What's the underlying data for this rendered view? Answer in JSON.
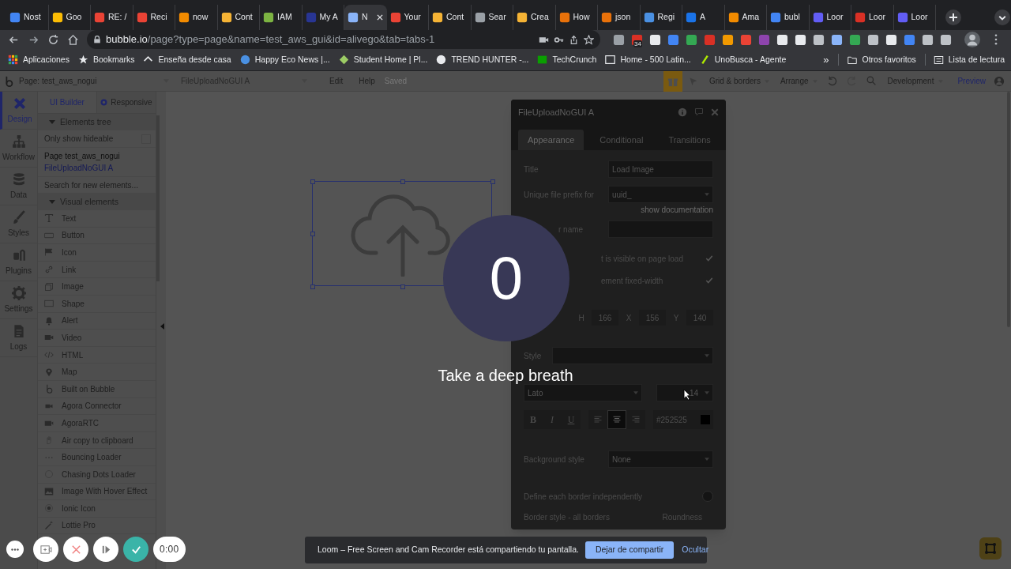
{
  "browser": {
    "tabs": [
      {
        "title": "Nost",
        "selected": false
      },
      {
        "title": "Goo",
        "selected": false
      },
      {
        "title": "RE: /",
        "selected": false
      },
      {
        "title": "Reci",
        "selected": false
      },
      {
        "title": "now",
        "selected": false
      },
      {
        "title": "Cont",
        "selected": false
      },
      {
        "title": "IAM",
        "selected": false
      },
      {
        "title": "My A",
        "selected": false
      },
      {
        "title": "N",
        "selected": true
      },
      {
        "title": "Your",
        "selected": false
      },
      {
        "title": "Cont",
        "selected": false
      },
      {
        "title": "Sear",
        "selected": false
      },
      {
        "title": "Crea",
        "selected": false
      },
      {
        "title": "How",
        "selected": false
      },
      {
        "title": "json",
        "selected": false
      },
      {
        "title": "Regi",
        "selected": false
      },
      {
        "title": "A",
        "selected": false
      },
      {
        "title": "Ama",
        "selected": false
      },
      {
        "title": "bubl",
        "selected": false
      },
      {
        "title": "Loor",
        "selected": false
      },
      {
        "title": "Loor",
        "selected": false
      },
      {
        "title": "Loor",
        "selected": false
      }
    ],
    "address": {
      "url": "**bubble.io**/page?type=page&name=test_aws_gui&id=alivego&tab=tabs-1"
    },
    "extension_badge": "34",
    "bookmarks": [
      "Aplicaciones",
      "Bookmarks",
      "Enseña desde casa",
      "Happy Eco News |...",
      "Student Home | Pl...",
      "TREND HUNTER -...",
      "TechCrunch",
      "Home - 500 Latin...",
      "UnoBusca - Agente"
    ],
    "bookmarks_more": "»",
    "other_bookmarks": "Otros favoritos",
    "reading_list": "Lista de lectura"
  },
  "editor": {
    "topbar": {
      "page_selector": "Page: test_aws_nogui",
      "element_selector": "FileUploadNoGUI A",
      "menu": [
        "Edit",
        "Help"
      ],
      "save_status": "Saved",
      "view_menus": [
        "Grid & borders",
        "Arrange"
      ],
      "environment": "Development",
      "preview": "Preview"
    },
    "nav": [
      {
        "label": "Design",
        "selected": true
      },
      {
        "label": "Workflow",
        "selected": false
      },
      {
        "label": "Data",
        "selected": false
      },
      {
        "label": "Styles",
        "selected": false
      },
      {
        "label": "Plugins",
        "selected": false
      },
      {
        "label": "Settings",
        "selected": false
      },
      {
        "label": "Logs",
        "selected": false
      }
    ],
    "panel_tabs": [
      {
        "label": "UI Builder",
        "selected": true
      },
      {
        "label": "Responsive",
        "selected": false
      }
    ],
    "elements_tree": {
      "header": "Elements tree",
      "expanded": true,
      "only_hideable": {
        "label": "Only show hideable",
        "checked": false
      },
      "tree": [
        {
          "label": "Page test_aws_nogui",
          "selected": false,
          "children": [
            {
              "label": "FileUploadNoGUI A",
              "selected": true
            }
          ]
        }
      ]
    },
    "search": {
      "placeholder": "Search for new elements..."
    },
    "visual_elements": {
      "header": "Visual elements",
      "expanded": true,
      "items": [
        "Text",
        "Button",
        "Icon",
        "Link",
        "Image",
        "Shape",
        "Alert",
        "Video",
        "HTML",
        "Map",
        "Built on Bubble",
        "Agora Connector",
        "AgoraRTC",
        "Air copy to clipboard",
        "Bouncing Loader",
        "Chasing Dots Loader",
        "Image With Hover Effect",
        "Ionic Icon",
        "Lottie Pro"
      ]
    },
    "property_panel": {
      "title": "FileUploadNoGUI A",
      "tabs": [
        {
          "label": "Appearance",
          "selected": true
        },
        {
          "label": "Conditional",
          "selected": false
        },
        {
          "label": "Transitions",
          "selected": false
        }
      ],
      "title_field": {
        "label": "Title",
        "value": "Load Image"
      },
      "prefix_field": {
        "label": "Unique file prefix for",
        "value": "uuid_"
      },
      "documentation_link": "show documentation",
      "name_field": {
        "label": "r name"
      },
      "checks": [
        {
          "label": "t is visible on page load",
          "checked": true
        },
        {
          "label": "ement fixed-width",
          "checked": true
        }
      ],
      "geometry": [
        {
          "label": "H",
          "value": "166"
        },
        {
          "label": "X",
          "value": "156"
        },
        {
          "label": "Y",
          "value": "140"
        }
      ],
      "style_label": "Style",
      "font": "Lato",
      "font_size": "14",
      "format_buttons": [
        "B",
        "I",
        "U"
      ],
      "alignment": [
        {
          "selected": false
        },
        {
          "selected": true
        },
        {
          "selected": false
        }
      ],
      "text_color": {
        "value": "#252525",
        "color": "#000000"
      },
      "background_style": {
        "label": "Background style",
        "value": "None"
      },
      "border_toggle": {
        "label": "Define each border independently",
        "on": false
      },
      "border_style_label": "Border style - all borders",
      "roundness_label": "Roundness"
    }
  },
  "countdown": {
    "count": "0",
    "message": "Take a deep breath"
  },
  "recorder": {
    "time": "0:00"
  },
  "share_bar": {
    "message": "Loom – Free Screen and Cam Recorder está compartiendo tu pantalla.",
    "stop_button": "Dejar de compartir",
    "hide_button": "Ocultar"
  }
}
